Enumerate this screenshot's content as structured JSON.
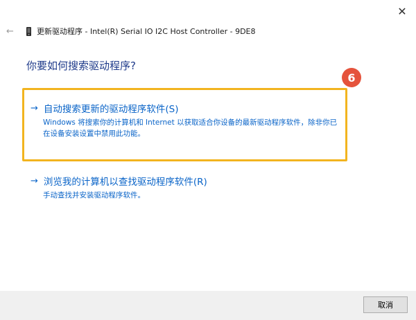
{
  "window": {
    "close_glyph": "✕",
    "back_glyph": "←",
    "title": "更新驱动程序 - Intel(R) Serial IO I2C Host Controller - 9DE8"
  },
  "heading": "你要如何搜索驱动程序?",
  "callout": {
    "number": "6",
    "color": "#e5533c",
    "highlight_color": "#f2b41f"
  },
  "options": [
    {
      "arrow": "→",
      "title": "自动搜索更新的驱动程序软件(S)",
      "description": "Windows 将搜索你的计算机和 Internet 以获取适合你设备的最新驱动程序软件，除非你已在设备安装设置中禁用此功能。"
    },
    {
      "arrow": "→",
      "title": "浏览我的计算机以查找驱动程序软件(R)",
      "description": "手动查找并安装驱动程序软件。"
    }
  ],
  "footer": {
    "cancel_label": "取消"
  },
  "colors": {
    "link": "#0a64c8",
    "heading": "#1e3a8a",
    "footer_bg": "#f0f0f0"
  },
  "icons": {
    "device": "device-icon"
  }
}
